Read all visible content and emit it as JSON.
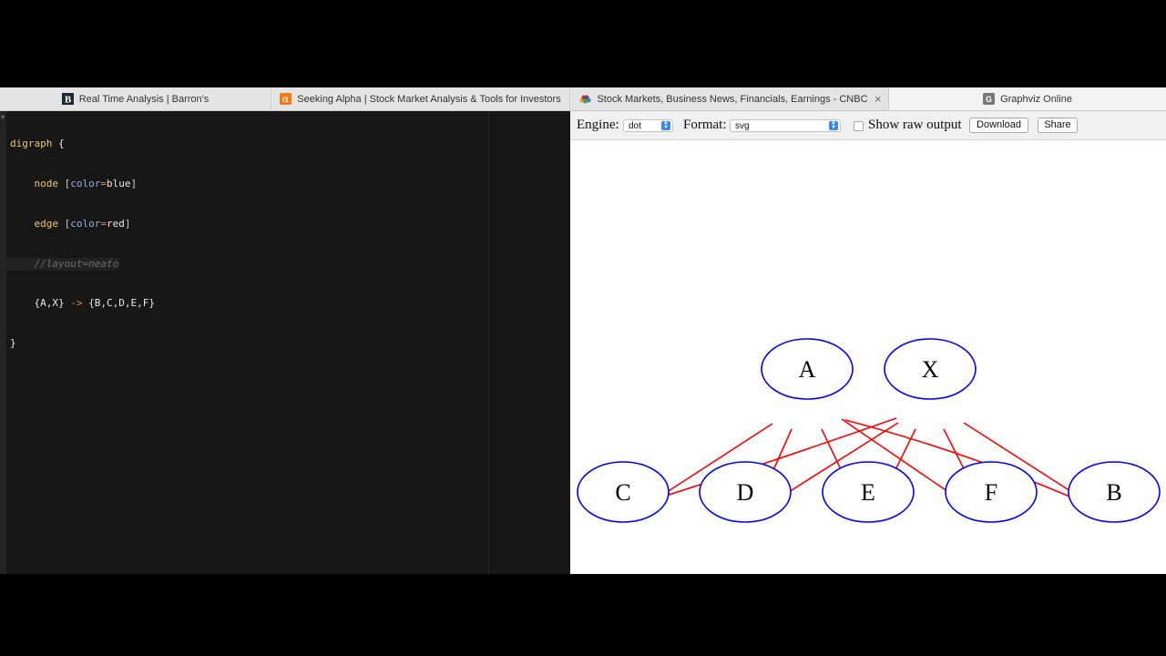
{
  "tabs": [
    {
      "title": "Real Time Analysis | Barron's",
      "icon": "barrons-b-icon"
    },
    {
      "title": "Seeking Alpha | Stock Market Analysis & Tools for Investors",
      "icon": "seeking-alpha-icon"
    },
    {
      "title": "Stock Markets, Business News, Financials, Earnings - CNBC",
      "icon": "cnbc-peacock-icon"
    },
    {
      "title": "Graphviz Online",
      "icon": "graphviz-g-icon",
      "active": true
    }
  ],
  "tab_close": "×",
  "editor": {
    "code": {
      "l1": {
        "kw": "digraph",
        "rest": " {"
      },
      "l2": {
        "indent": "    ",
        "kw": "node",
        "open": " [",
        "attr": "color",
        "eq": "=",
        "val": "blue",
        "close": "]"
      },
      "l3": {
        "indent": "    ",
        "kw": "edge",
        "open": " [",
        "attr": "color",
        "eq": "=",
        "val": "red",
        "close": "]"
      },
      "l4": {
        "indent": "    ",
        "comment": "//layout=neato"
      },
      "l5": {
        "indent": "    ",
        "lhs": "{A,X}",
        "arrow": " -> ",
        "rhs": "{B,C,D,E,F}"
      },
      "l6": {
        "text": "}"
      }
    }
  },
  "toolbar": {
    "engine_label": "Engine:",
    "engine_value": "dot",
    "format_label": "Format:",
    "format_value": "svg",
    "raw_label": "Show raw output",
    "raw_checked": false,
    "download_label": "Download",
    "share_label": "Share"
  },
  "graph": {
    "node_color": "#0000ff",
    "edge_color": "#ff0000",
    "nodes": [
      "A",
      "X",
      "C",
      "D",
      "E",
      "F",
      "B"
    ],
    "edges": [
      [
        "A",
        "C"
      ],
      [
        "A",
        "D"
      ],
      [
        "A",
        "E"
      ],
      [
        "A",
        "F"
      ],
      [
        "A",
        "B"
      ],
      [
        "X",
        "C"
      ],
      [
        "X",
        "D"
      ],
      [
        "X",
        "E"
      ],
      [
        "X",
        "F"
      ],
      [
        "X",
        "B"
      ]
    ]
  }
}
